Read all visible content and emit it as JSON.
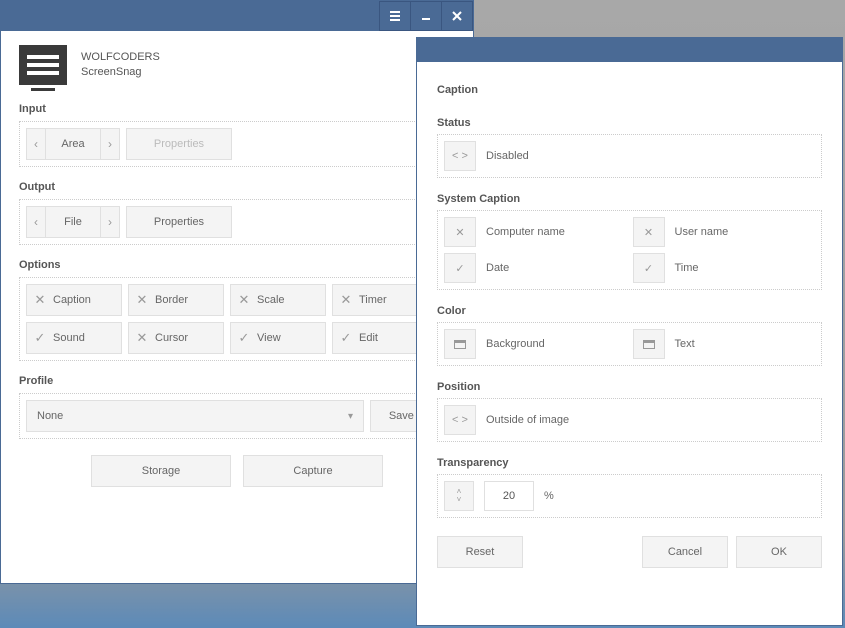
{
  "brand": {
    "company": "WOLFCODERS",
    "product": "ScreenSnag"
  },
  "input": {
    "label": "Input",
    "selected": "Area",
    "properties": "Properties"
  },
  "output": {
    "label": "Output",
    "selected": "File",
    "properties": "Properties"
  },
  "options": {
    "label": "Options",
    "items": [
      {
        "name": "Caption",
        "checked": false
      },
      {
        "name": "Border",
        "checked": false
      },
      {
        "name": "Scale",
        "checked": false
      },
      {
        "name": "Timer",
        "checked": false
      },
      {
        "name": "Sound",
        "checked": true
      },
      {
        "name": "Cursor",
        "checked": false
      },
      {
        "name": "View",
        "checked": true
      },
      {
        "name": "Edit",
        "checked": true
      }
    ]
  },
  "profile": {
    "label": "Profile",
    "value": "None",
    "save_as": "Save As"
  },
  "actions": {
    "storage": "Storage",
    "capture": "Capture"
  },
  "dialog": {
    "title": "Caption",
    "status": {
      "label": "Status",
      "value": "Disabled"
    },
    "system_caption": {
      "label": "System Caption",
      "items": [
        {
          "name": "Computer name",
          "checked": false
        },
        {
          "name": "User name",
          "checked": false
        },
        {
          "name": "Date",
          "checked": true
        },
        {
          "name": "Time",
          "checked": true
        }
      ]
    },
    "color": {
      "label": "Color",
      "items": [
        {
          "name": "Background"
        },
        {
          "name": "Text"
        }
      ]
    },
    "position": {
      "label": "Position",
      "value": "Outside of image"
    },
    "transparency": {
      "label": "Transparency",
      "value": "20",
      "unit": "%"
    },
    "buttons": {
      "reset": "Reset",
      "cancel": "Cancel",
      "ok": "OK"
    }
  }
}
